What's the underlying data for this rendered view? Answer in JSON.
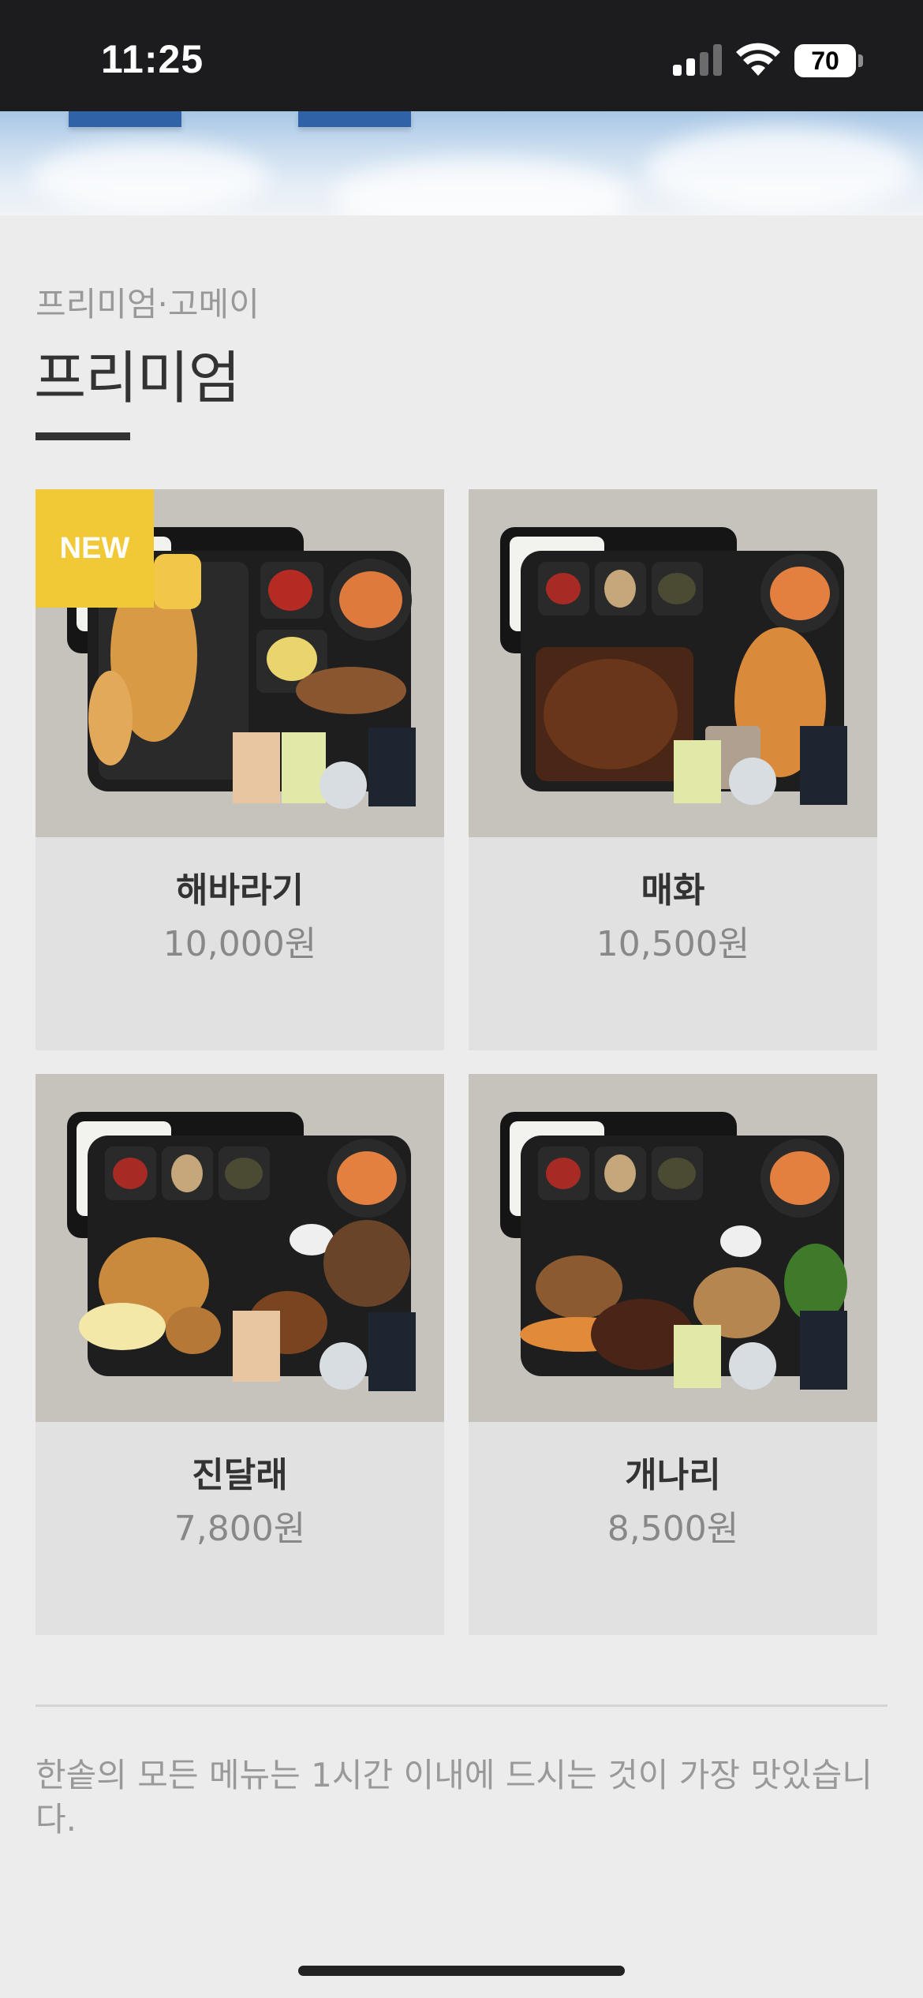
{
  "status_bar": {
    "time": "11:25",
    "battery": "70",
    "icons": [
      "signal-icon",
      "wifi-icon",
      "battery-icon"
    ]
  },
  "section": {
    "category": "프리미엄·고메이",
    "title": "프리미엄"
  },
  "products": [
    {
      "name": "해바라기",
      "price": "10,000원",
      "badge": "NEW",
      "image_icon": "lunchbox-image"
    },
    {
      "name": "매화",
      "price": "10,500원",
      "badge": "",
      "image_icon": "lunchbox-image"
    },
    {
      "name": "진달래",
      "price": "7,800원",
      "badge": "",
      "image_icon": "lunchbox-image"
    },
    {
      "name": "개나리",
      "price": "8,500원",
      "badge": "",
      "image_icon": "lunchbox-image"
    }
  ],
  "footer": {
    "note": "한솥의 모든 메뉴는 1시간 이내에 드시는 것이 가장 맛있습니다."
  },
  "colors": {
    "background": "#ececec",
    "card": "#e1e1e1",
    "photo_background": "#c6c3bd",
    "new_badge": "#f1c937",
    "banner_tab": "#2f62a7"
  }
}
